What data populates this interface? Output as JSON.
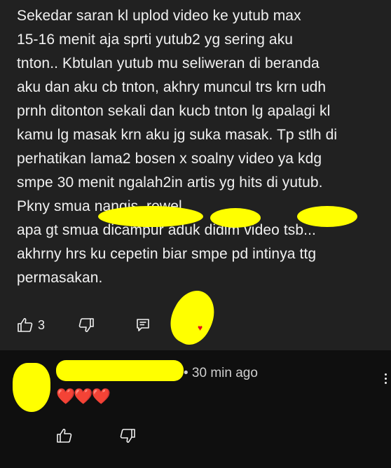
{
  "comment": {
    "text": "Sekedar saran kl uplod video ke yutub max\n15-16 menit aja sprti yutub2 yg sering aku\ntnton.. Kbtulan yutub mu seliweran di beranda\naku dan aku cb tnton, akhry muncul trs krn udh\nprnh ditonton sekali dan kucb tnton lg apalagi kl\nkamu lg masak krn aku jg suka masak. Tp stlh di\nperhatikan lama2 bosen x  soalny video ya kdg\nsmpe 30 menit ngalah2in artis yg hits di yutub.\nPkny smua              nangis,          rewel,\napa gt smua dicampur aduk didlm video tsb...\nakhrny hrs ku cepetin biar smpe pd intinya  ttg\npermasakan.",
    "like_count": "3",
    "icons": {
      "like": "thumbs-up-icon",
      "dislike": "thumbs-down-icon",
      "reply": "reply-comment-icon"
    }
  },
  "reply": {
    "author_redacted": true,
    "time": "• 30 min ago",
    "hearts": "❤️❤️❤️",
    "icons": {
      "like": "thumbs-up-icon",
      "dislike": "thumbs-down-icon",
      "more": "more-vert-icon"
    }
  },
  "colors": {
    "comment_bg": "#212121",
    "page_bg": "#0f0f0f",
    "text": "#f1f1f1",
    "redaction": "#ffff00",
    "heart": "#e3001b"
  }
}
